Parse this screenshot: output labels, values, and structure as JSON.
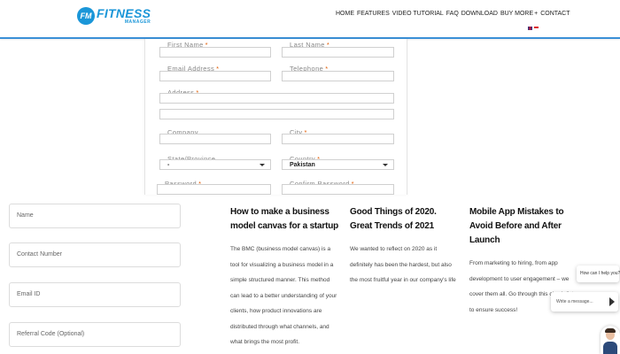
{
  "brand": {
    "badge": "FM",
    "name": "FITNESS",
    "sub": "MANAGER"
  },
  "nav": {
    "items": [
      "HOME",
      "FEATURES",
      "VIDEO TUTORIAL",
      "FAQ",
      "DOWNLOAD",
      "BUY MORE",
      "+",
      "CONTACT"
    ]
  },
  "signup_form": {
    "first_name": "First Name",
    "last_name": "Last Name",
    "email": "Email Address",
    "telephone": "Telephone",
    "address": "Address",
    "company": "Company",
    "city": "City",
    "state": "State/Province",
    "state_value": "-",
    "country": "Country",
    "country_value": "Pakistan",
    "password": "Password",
    "confirm_password": "Confirm Password",
    "required_mark": "*"
  },
  "contact_form": {
    "name_placeholder": "Name",
    "contact_placeholder": "Contact Number",
    "email_placeholder": "Email ID",
    "referral_placeholder": "Referral Code (Optional)"
  },
  "articles": [
    {
      "title": "How to make a business model canvas for a startup",
      "body": "The BMC (business model canvas) is a tool for visualizing a business model in a simple structured manner. This method can lead to a better understanding of your clients, how product innovations are distributed through what channels, and what brings the most profit."
    },
    {
      "title": "Good Things of 2020. Great Trends of 2021",
      "body": "We wanted to reflect on 2020 as it definitely has been the hardest, but also the most fruitful year in our company's life"
    },
    {
      "title": "Mobile App Mistakes to Avoid Before and After Launch",
      "body": "From marketing to hiring, from app development to user engagement – we cover them all. Go through this check-list to ensure success!"
    }
  ],
  "chat": {
    "greeting": "How can I help you?",
    "input_placeholder": "Write a message..."
  },
  "colors": {
    "brand_blue": "#1a96d8",
    "required": "#e05a00"
  }
}
